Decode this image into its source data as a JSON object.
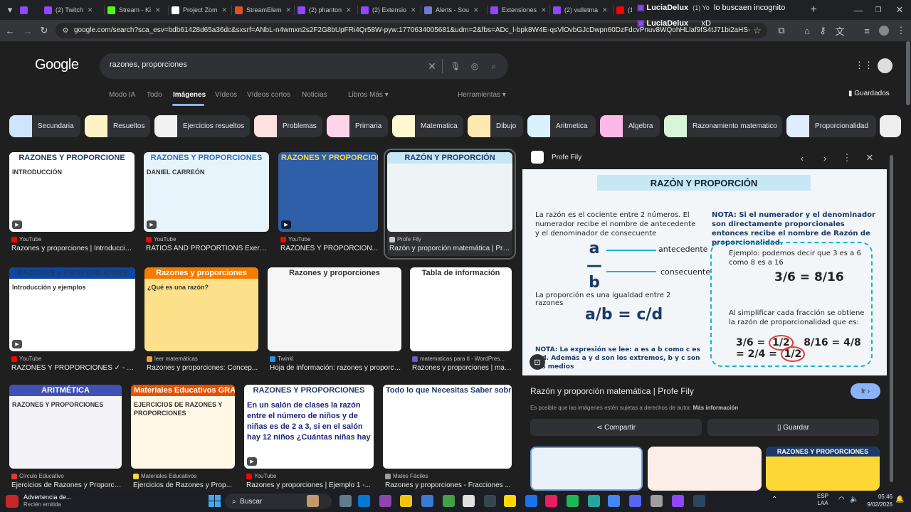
{
  "tabs": [
    {
      "title": "Twitch",
      "color": "#9146ff"
    },
    {
      "title": "(2) Twitch",
      "color": "#9146ff"
    },
    {
      "title": "Stream - Ki",
      "color": "#53fc18"
    },
    {
      "title": "Project Zom",
      "color": "#ffffff"
    },
    {
      "title": "StreamElem",
      "color": "#e44d26"
    },
    {
      "title": "(2) phanton",
      "color": "#9146ff"
    },
    {
      "title": "(2) Extensio",
      "color": "#9146ff"
    },
    {
      "title": "Alerts - Sou",
      "color": "#6c7bd1"
    },
    {
      "title": "Extensiones",
      "color": "#9146ff"
    },
    {
      "title": "(2) vulletma",
      "color": "#9146ff"
    },
    {
      "title": "(1",
      "color": "#ff0000"
    }
  ],
  "chat_overlay": {
    "line1_user": "LuciaDelux",
    "line1_msg": "lo buscaen incognito",
    "line1_extra": "(1) Yo",
    "line2_user": "LuciaDelux",
    "line2_msg": "xD"
  },
  "toolbar": {
    "url": "google.com/search?sca_esv=bdb61428d65a36dc&sxsrf=ANbL-n4wmxn2s2F2G8bUpFRi4Qr58W-pyw:1770634005681&udm=2&fbs=ADc_l-bpk8W4E-qsVlOvbGJcDwpn60DzFdcvPnuv8WQohHLlaf9fS4tJ71bi2aHS-Pmeg3gf3Rx3g..."
  },
  "search": {
    "logo": "Google",
    "query": "razones, proporciones"
  },
  "nav": {
    "tabs": [
      "Modo IA",
      "Todo",
      "Imágenes",
      "Vídeos",
      "Vídeos cortos",
      "Noticias",
      "Libros",
      "Más"
    ],
    "tools": "Herramientas",
    "saved": "Guardados"
  },
  "chips": [
    "Secundaria",
    "Resueltos",
    "Ejercicios resueltos",
    "Problemas",
    "Primaria",
    "Matematica",
    "Dibujo",
    "Aritmetica",
    "Algebra",
    "Razonamiento matematico",
    "Proporcionalidad"
  ],
  "results": [
    {
      "source": "YouTube",
      "title": "Razones y proporciones | Introducció...",
      "headline": "RAZONES Y PROPORCIONE",
      "sub": "INTRODUCCIÓN"
    },
    {
      "source": "YouTube",
      "title": "RATIOS AND PROPORTIONS Exerci...",
      "headline": "RAZONES Y PROPORCIONES",
      "sub": "DANIEL CARREÓN"
    },
    {
      "source": "YouTube",
      "title": "RAZONES Y PROPORCION...",
      "headline": "RAZONES Y PROPORCIONES",
      "sub": ""
    },
    {
      "source": "Profe Fily",
      "title": "Razón y proporción matemática | Pro...",
      "headline": "RAZÓN Y PROPORCIÓN",
      "sub": ""
    },
    {
      "source": "YouTube",
      "title": "RAZONES Y PROPORCIONES ✓ - In...",
      "headline": "RAZONES y PROPORCIONES",
      "sub": "Introducción y ejemplos"
    },
    {
      "source": "leer matemáticas",
      "title": "Razones y proporciones: Concep...",
      "headline": "Razones y proporciones",
      "sub": "¿Qué es una razón?"
    },
    {
      "source": "Twinkl",
      "title": "Hoja de información: razones y proporci...",
      "headline": "Razones y proporciones",
      "sub": ""
    },
    {
      "source": "matematicas para ti - WordPres...",
      "title": "Razones y proporciones | mat...",
      "headline": "Tabla de información",
      "sub": ""
    },
    {
      "source": "Círculo Educativo",
      "title": "Ejercicios de Razones y Proporci...",
      "headline": "ARITMÉTICA",
      "sub": "RAZONES Y PROPORCIONES"
    },
    {
      "source": "Materiales Educativos",
      "title": "Ejercicios de Razones y Prop...",
      "headline": "Materiales Educativos GRATIS",
      "sub": "EJERCICIOS DE RAZONES Y PROPORCIONES"
    },
    {
      "source": "YouTube",
      "title": "Razones y proporciones | Ejemplo 1 -...",
      "headline": "RAZONES Y PROPORCIONES",
      "sub": "En un salón de clases la razón entre el número de niños y de niñas es de 2 a 3, si en el salón hay 12 niños ¿Cuántas niñas hay"
    },
    {
      "source": "Mates Fáciles",
      "title": "Razones y proporciones - Fracciones ...",
      "headline": "Todo lo que Necesitas Saber sobre las Fracciones (casi todo)",
      "sub": ""
    }
  ],
  "preview": {
    "source": "Profe Fily",
    "img_title": "RAZÓN Y PROPORCIÓN",
    "razon_def": "La razón es el cociente entre 2 números. El numerador recibe el nombre de antecedente y el denominador de consecuente",
    "antecedente": "antecedente",
    "consecuente": "consecuente",
    "nota": "NOTA: Si el numerador y el denominador son directamente proporcionales entonces recibe el nombre de Razón de proporcionalidad.",
    "ejemplo": "Ejemplo: podemos decir que 3 es a 6 como 8 es a 16",
    "proporcion_def": "La proporción es una igualdad entre 2 razones",
    "simplificar": "Al simplificar cada fracción se obtiene la razón de proporcionalidad que es:",
    "nota2": "NOTA: La expresión se lee: a es a b como c es a d. Además a y d son los extremos, b y c son los medios",
    "title": "Razón y proporción matemática | Profe Fily",
    "go_label": "Ir",
    "copyright": "Es posible que las imágenes estén sujetas a derechos de autor.",
    "more_info": "Más información",
    "share": "Compartir",
    "save": "Guardar"
  },
  "taskbar": {
    "notif_title": "Advertencia de...",
    "notif_sub": "Recién emitida",
    "search": "Buscar",
    "lang": "ESP",
    "lang2": "LAA",
    "time": "05:46",
    "date": "9/02/2026"
  }
}
